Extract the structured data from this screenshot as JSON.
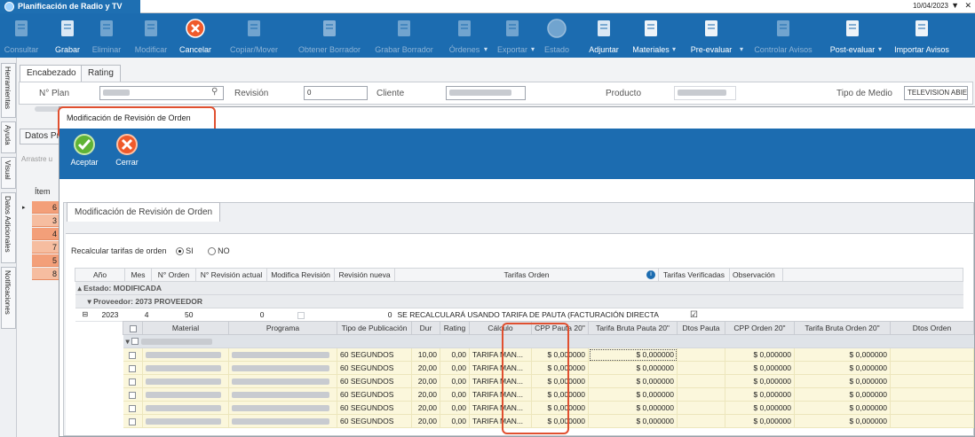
{
  "window": {
    "title": "Planificación de Radio y TV",
    "date": "10/04/2023"
  },
  "toolbar": [
    {
      "label": "Consultar",
      "enabled": false
    },
    {
      "label": "Grabar",
      "enabled": true
    },
    {
      "label": "Eliminar",
      "enabled": false
    },
    {
      "label": "Modificar",
      "enabled": false
    },
    {
      "label": "Cancelar",
      "enabled": true
    },
    {
      "label": "Copiar/Mover",
      "enabled": false
    },
    {
      "label": "Obtener Borrador",
      "enabled": false
    },
    {
      "label": "Grabar Borrador",
      "enabled": false
    },
    {
      "label": "Órdenes",
      "enabled": false
    },
    {
      "label": "Exportar",
      "enabled": false
    },
    {
      "label": "Estado",
      "enabled": false
    },
    {
      "label": "Adjuntar",
      "enabled": true
    },
    {
      "label": "Materiales",
      "enabled": true
    },
    {
      "label": "Pre-evaluar",
      "enabled": true
    },
    {
      "label": "Controlar Avisos",
      "enabled": false
    },
    {
      "label": "Post-evaluar",
      "enabled": true
    },
    {
      "label": "Importar Avisos",
      "enabled": true
    }
  ],
  "sidebar": [
    "Herramientas",
    "Ayuda",
    "Visual",
    "Datos Adicionales",
    "Notificaciones"
  ],
  "header": {
    "tabs": [
      "Encabezado",
      "Rating"
    ],
    "plan_label": "N° Plan",
    "revision_label": "Revisión",
    "revision_value": "0",
    "cliente_label": "Cliente",
    "producto_label": "Producto",
    "tipo_label": "Tipo de Medio",
    "tipo_value": "TELEVISION ABIE"
  },
  "background": {
    "datos_tab": "Datos Pr",
    "drag_hint": "Arrastre u",
    "item_header": "Ítem",
    "items": [
      "6",
      "3",
      "4",
      "7",
      "5",
      "8"
    ]
  },
  "modal": {
    "title": "Modificación de Revisión de Orden",
    "accept_label": "Aceptar",
    "close_label": "Cerrar",
    "panel_tab": "Modificación de Revisión de Orden",
    "recalc_label": "Recalcular tarifas de orden",
    "opt_si": "SI",
    "opt_no": "NO"
  },
  "grid": {
    "columns": [
      "Año",
      "Mes",
      "N° Orden",
      "N° Revisión actual",
      "Modifica Revisión",
      "Revisión nueva",
      "Tarifas Orden",
      "Tarifas Verificadas",
      "Observación"
    ],
    "group_estado": "Estado: MODIFICADA",
    "group_proveedor": "Proveedor: 2073 PROVEEDOR",
    "summary": {
      "anio": "2023",
      "mes": "4",
      "orden": "50",
      "rev_actual": "0",
      "rev_nueva": "0",
      "tarifas": "SE RECALCULARÁ USANDO TARIFA DE PAUTA (FACTURACIÓN DIRECTA)"
    },
    "detail_columns": [
      "Material",
      "Programa",
      "Tipo de Publicación",
      "Dur",
      "Rating",
      "Cálculo",
      "CPP Pauta 20\"",
      "Tarifa Bruta Pauta 20\"",
      "Dtos Pauta",
      "CPP Orden 20\"",
      "Tarifa Bruta Orden 20\"",
      "Dtos Orden"
    ],
    "detail_rows": [
      {
        "tipo": "60 SEGUNDOS",
        "dur": "10,00",
        "rating": "0,00",
        "calculo": "TARIFA MAN...",
        "cpp_pauta": "$ 0,000000",
        "tb_pauta": "$ 0,000000",
        "cpp_orden": "$ 0,000000",
        "tb_orden": "$ 0,000000"
      },
      {
        "tipo": "60 SEGUNDOS",
        "dur": "20,00",
        "rating": "0,00",
        "calculo": "TARIFA MAN...",
        "cpp_pauta": "$ 0,000000",
        "tb_pauta": "$ 0,000000",
        "cpp_orden": "$ 0,000000",
        "tb_orden": "$ 0,000000"
      },
      {
        "tipo": "60 SEGUNDOS",
        "dur": "20,00",
        "rating": "0,00",
        "calculo": "TARIFA MAN...",
        "cpp_pauta": "$ 0,000000",
        "tb_pauta": "$ 0,000000",
        "cpp_orden": "$ 0,000000",
        "tb_orden": "$ 0,000000"
      },
      {
        "tipo": "60 SEGUNDOS",
        "dur": "20,00",
        "rating": "0,00",
        "calculo": "TARIFA MAN...",
        "cpp_pauta": "$ 0,000000",
        "tb_pauta": "$ 0,000000",
        "cpp_orden": "$ 0,000000",
        "tb_orden": "$ 0,000000"
      },
      {
        "tipo": "60 SEGUNDOS",
        "dur": "20,00",
        "rating": "0,00",
        "calculo": "TARIFA MAN...",
        "cpp_pauta": "$ 0,000000",
        "tb_pauta": "$ 0,000000",
        "cpp_orden": "$ 0,000000",
        "tb_orden": "$ 0,000000"
      },
      {
        "tipo": "60 SEGUNDOS",
        "dur": "20,00",
        "rating": "0,00",
        "calculo": "TARIFA MAN...",
        "cpp_pauta": "$ 0,000000",
        "tb_pauta": "$ 0,000000",
        "cpp_orden": "$ 0,000000",
        "tb_orden": "$ 0,000000"
      }
    ]
  },
  "colors": {
    "toolbar": "#1c6cb0",
    "highlight": "#e05030",
    "row_orange": "#f39f79",
    "row_yellow": "#fbf7dc"
  }
}
